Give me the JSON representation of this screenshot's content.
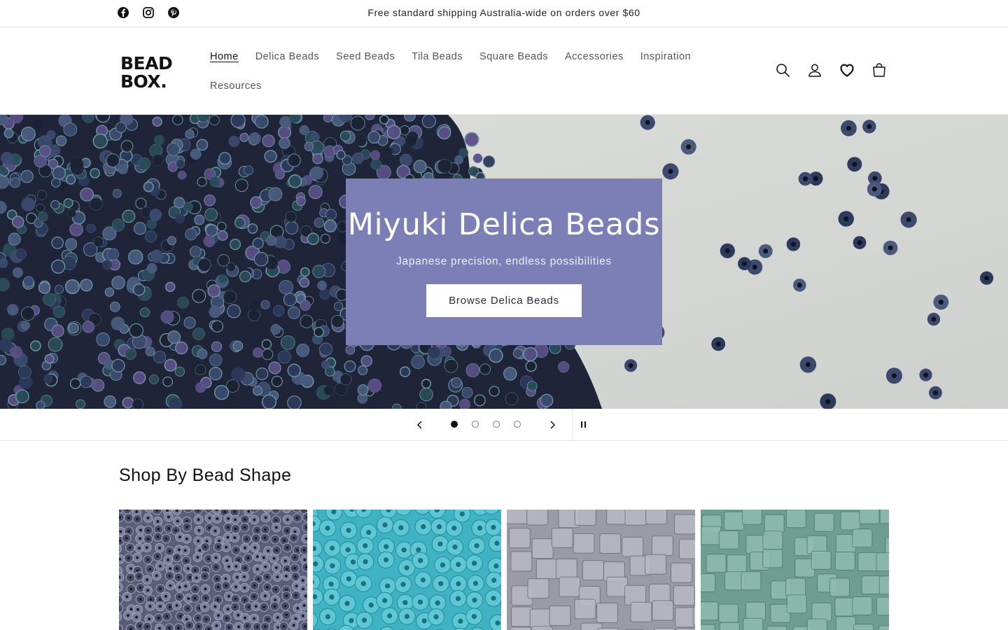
{
  "announcement": {
    "text": "Free standard shipping Australia-wide on orders over $60",
    "social_icons": [
      "facebook-icon",
      "instagram-icon",
      "pinterest-icon"
    ]
  },
  "header": {
    "logo_text_line1": "BEAD",
    "logo_text_line2": "BOX.",
    "nav": [
      {
        "label": "Home",
        "active": true
      },
      {
        "label": "Delica Beads",
        "active": false
      },
      {
        "label": "Seed Beads",
        "active": false
      },
      {
        "label": "Tila Beads",
        "active": false
      },
      {
        "label": "Square Beads",
        "active": false
      },
      {
        "label": "Accessories",
        "active": false
      },
      {
        "label": "Inspiration",
        "active": false
      },
      {
        "label": "Resources",
        "active": false
      }
    ],
    "icons": [
      "search-icon",
      "account-icon",
      "wishlist-heart-icon",
      "cart-icon"
    ]
  },
  "hero": {
    "title": "Miyuki Delica Beads",
    "subtitle": "Japanese precision, endless possibilities",
    "button_label": "Browse Delica Beads",
    "box_color": "#7b7fb6"
  },
  "slider": {
    "slide_count": 4,
    "active_slide": 1,
    "icons": [
      "chevron-left-icon",
      "chevron-right-icon",
      "pause-icon"
    ]
  },
  "shop_by_shape": {
    "title": "Shop By Bead Shape",
    "tiles": [
      {
        "color": "#5a5f78"
      },
      {
        "color": "#3fb3c4"
      },
      {
        "color": "#9a9ba6"
      },
      {
        "color": "#6e9e90"
      }
    ]
  },
  "colors": {
    "text": "#121212",
    "border": "#e6e6e6",
    "hero_box": "#7b7fb6"
  }
}
